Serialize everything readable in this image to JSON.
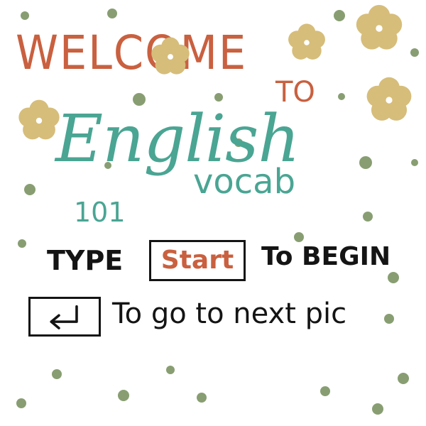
{
  "title": {
    "welcome": "WELCOME",
    "to": "TO",
    "english": "English",
    "vocab": "vocab",
    "number": "101"
  },
  "instructions": {
    "type_label": "TYPE",
    "start_word": "Start",
    "begin_label": "To BEGIN",
    "enter_icon": "enter-key-icon",
    "next_label": "To go to next pic"
  },
  "colors": {
    "welcome": "#c9603f",
    "english": "#4aa593",
    "start_word": "#c9603f",
    "text_dark": "#141414",
    "dots": "#889e72",
    "flower_petal": "#d6bd7a",
    "flower_center": "#ffffff"
  },
  "decorations": {
    "flower_icon": "flower-icon",
    "dot_icon": "dot-icon"
  }
}
